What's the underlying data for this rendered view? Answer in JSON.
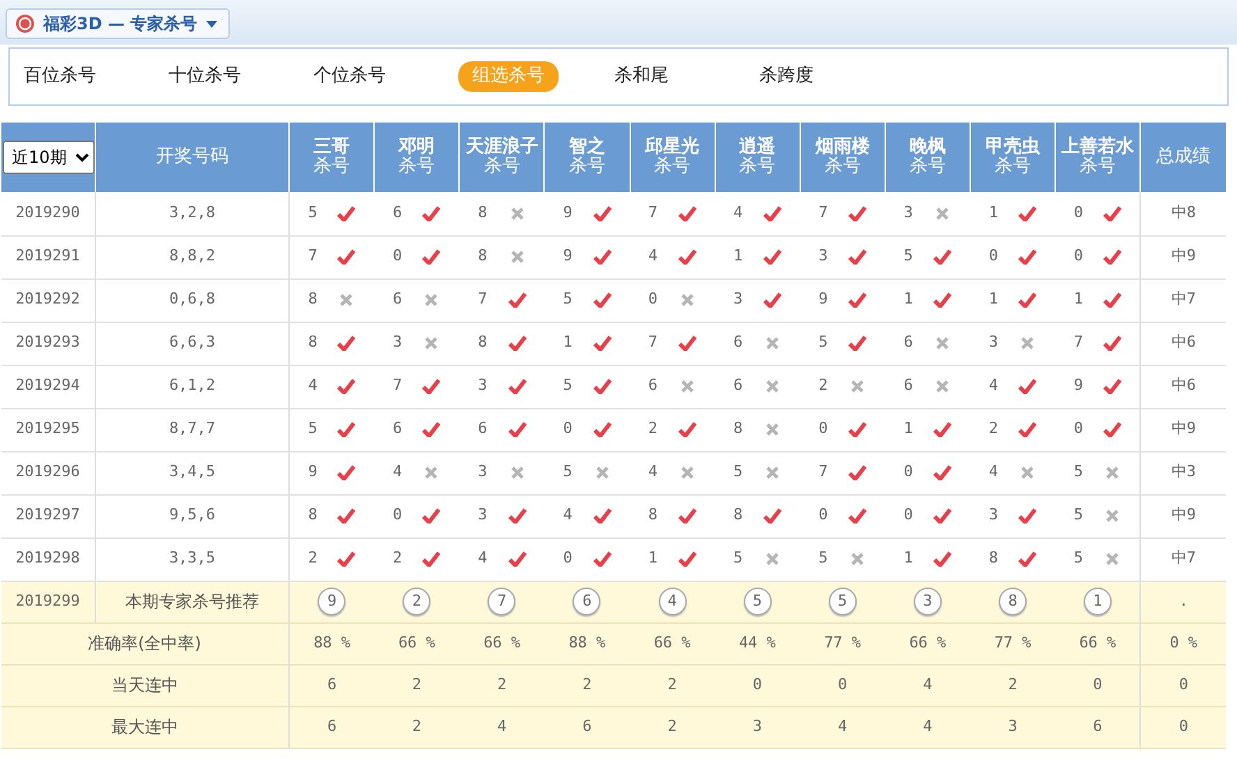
{
  "header_tab": {
    "title": "福彩3D — 专家杀号"
  },
  "nav": [
    {
      "label": "百位杀号",
      "selected": false
    },
    {
      "label": "十位杀号",
      "selected": false
    },
    {
      "label": "个位杀号",
      "selected": false
    },
    {
      "label": "组选杀号",
      "selected": true
    },
    {
      "label": "杀和尾",
      "selected": false
    },
    {
      "label": "杀跨度",
      "selected": false
    }
  ],
  "table": {
    "period_select": "近10期",
    "draw_heading": "开奖号码",
    "total_heading": "总成绩",
    "experts": [
      {
        "name": "三哥",
        "sub": "杀号"
      },
      {
        "name": "邓明",
        "sub": "杀号"
      },
      {
        "name": "天涯浪子",
        "sub": "杀号"
      },
      {
        "name": "智之",
        "sub": "杀号"
      },
      {
        "name": "邱星光",
        "sub": "杀号"
      },
      {
        "name": "逍遥",
        "sub": "杀号"
      },
      {
        "name": "烟雨楼",
        "sub": "杀号"
      },
      {
        "name": "晚枫",
        "sub": "杀号"
      },
      {
        "name": "甲壳虫",
        "sub": "杀号"
      },
      {
        "name": "上善若水",
        "sub": "杀号"
      }
    ],
    "rows": [
      {
        "issue": "2019290",
        "draw": "3,2,8",
        "total": "中8",
        "picks": [
          {
            "number": "5",
            "hit": true
          },
          {
            "number": "6",
            "hit": true
          },
          {
            "number": "8",
            "hit": false
          },
          {
            "number": "9",
            "hit": true
          },
          {
            "number": "7",
            "hit": true
          },
          {
            "number": "4",
            "hit": true
          },
          {
            "number": "7",
            "hit": true
          },
          {
            "number": "3",
            "hit": false
          },
          {
            "number": "1",
            "hit": true
          },
          {
            "number": "0",
            "hit": true
          }
        ]
      },
      {
        "issue": "2019291",
        "draw": "8,8,2",
        "total": "中9",
        "picks": [
          {
            "number": "7",
            "hit": true
          },
          {
            "number": "0",
            "hit": true
          },
          {
            "number": "8",
            "hit": false
          },
          {
            "number": "9",
            "hit": true
          },
          {
            "number": "4",
            "hit": true
          },
          {
            "number": "1",
            "hit": true
          },
          {
            "number": "3",
            "hit": true
          },
          {
            "number": "5",
            "hit": true
          },
          {
            "number": "0",
            "hit": true
          },
          {
            "number": "0",
            "hit": true
          }
        ]
      },
      {
        "issue": "2019292",
        "draw": "0,6,8",
        "total": "中7",
        "picks": [
          {
            "number": "8",
            "hit": false
          },
          {
            "number": "6",
            "hit": false
          },
          {
            "number": "7",
            "hit": true
          },
          {
            "number": "5",
            "hit": true
          },
          {
            "number": "0",
            "hit": false
          },
          {
            "number": "3",
            "hit": true
          },
          {
            "number": "9",
            "hit": true
          },
          {
            "number": "1",
            "hit": true
          },
          {
            "number": "1",
            "hit": true
          },
          {
            "number": "1",
            "hit": true
          }
        ]
      },
      {
        "issue": "2019293",
        "draw": "6,6,3",
        "total": "中6",
        "picks": [
          {
            "number": "8",
            "hit": true
          },
          {
            "number": "3",
            "hit": false
          },
          {
            "number": "8",
            "hit": true
          },
          {
            "number": "1",
            "hit": true
          },
          {
            "number": "7",
            "hit": true
          },
          {
            "number": "6",
            "hit": false
          },
          {
            "number": "5",
            "hit": true
          },
          {
            "number": "6",
            "hit": false
          },
          {
            "number": "3",
            "hit": false
          },
          {
            "number": "7",
            "hit": true
          }
        ]
      },
      {
        "issue": "2019294",
        "draw": "6,1,2",
        "total": "中6",
        "picks": [
          {
            "number": "4",
            "hit": true
          },
          {
            "number": "7",
            "hit": true
          },
          {
            "number": "3",
            "hit": true
          },
          {
            "number": "5",
            "hit": true
          },
          {
            "number": "6",
            "hit": false
          },
          {
            "number": "6",
            "hit": false
          },
          {
            "number": "2",
            "hit": false
          },
          {
            "number": "6",
            "hit": false
          },
          {
            "number": "4",
            "hit": true
          },
          {
            "number": "9",
            "hit": true
          }
        ]
      },
      {
        "issue": "2019295",
        "draw": "8,7,7",
        "total": "中9",
        "picks": [
          {
            "number": "5",
            "hit": true
          },
          {
            "number": "6",
            "hit": true
          },
          {
            "number": "6",
            "hit": true
          },
          {
            "number": "0",
            "hit": true
          },
          {
            "number": "2",
            "hit": true
          },
          {
            "number": "8",
            "hit": false
          },
          {
            "number": "0",
            "hit": true
          },
          {
            "number": "1",
            "hit": true
          },
          {
            "number": "2",
            "hit": true
          },
          {
            "number": "0",
            "hit": true
          }
        ]
      },
      {
        "issue": "2019296",
        "draw": "3,4,5",
        "total": "中3",
        "picks": [
          {
            "number": "9",
            "hit": true
          },
          {
            "number": "4",
            "hit": false
          },
          {
            "number": "3",
            "hit": false
          },
          {
            "number": "5",
            "hit": false
          },
          {
            "number": "4",
            "hit": false
          },
          {
            "number": "5",
            "hit": false
          },
          {
            "number": "7",
            "hit": true
          },
          {
            "number": "0",
            "hit": true
          },
          {
            "number": "4",
            "hit": false
          },
          {
            "number": "5",
            "hit": false
          }
        ]
      },
      {
        "issue": "2019297",
        "draw": "9,5,6",
        "total": "中9",
        "picks": [
          {
            "number": "8",
            "hit": true
          },
          {
            "number": "0",
            "hit": true
          },
          {
            "number": "3",
            "hit": true
          },
          {
            "number": "4",
            "hit": true
          },
          {
            "number": "8",
            "hit": true
          },
          {
            "number": "8",
            "hit": true
          },
          {
            "number": "0",
            "hit": true
          },
          {
            "number": "0",
            "hit": true
          },
          {
            "number": "3",
            "hit": true
          },
          {
            "number": "5",
            "hit": false
          }
        ]
      },
      {
        "issue": "2019298",
        "draw": "3,3,5",
        "total": "中7",
        "picks": [
          {
            "number": "2",
            "hit": true
          },
          {
            "number": "2",
            "hit": true
          },
          {
            "number": "4",
            "hit": true
          },
          {
            "number": "0",
            "hit": true
          },
          {
            "number": "1",
            "hit": true
          },
          {
            "number": "5",
            "hit": false
          },
          {
            "number": "5",
            "hit": false
          },
          {
            "number": "1",
            "hit": true
          },
          {
            "number": "8",
            "hit": true
          },
          {
            "number": "5",
            "hit": false
          }
        ]
      }
    ],
    "recommend": {
      "issue": "2019299",
      "label": "本期专家杀号推荐",
      "numbers": [
        "9",
        "2",
        "7",
        "6",
        "4",
        "5",
        "5",
        "3",
        "8",
        "1"
      ],
      "total": "."
    },
    "stats": [
      {
        "label": "准确率(全中率)",
        "values": [
          "88 %",
          "66 %",
          "66 %",
          "88 %",
          "66 %",
          "44 %",
          "77 %",
          "66 %",
          "77 %",
          "66 %"
        ],
        "total": "0 %"
      },
      {
        "label": "当天连中",
        "values": [
          "6",
          "2",
          "2",
          "2",
          "2",
          "0",
          "0",
          "4",
          "2",
          "0"
        ],
        "total": "0"
      },
      {
        "label": "最大连中",
        "values": [
          "6",
          "2",
          "4",
          "6",
          "2",
          "3",
          "4",
          "4",
          "3",
          "6"
        ],
        "total": "0"
      }
    ]
  }
}
